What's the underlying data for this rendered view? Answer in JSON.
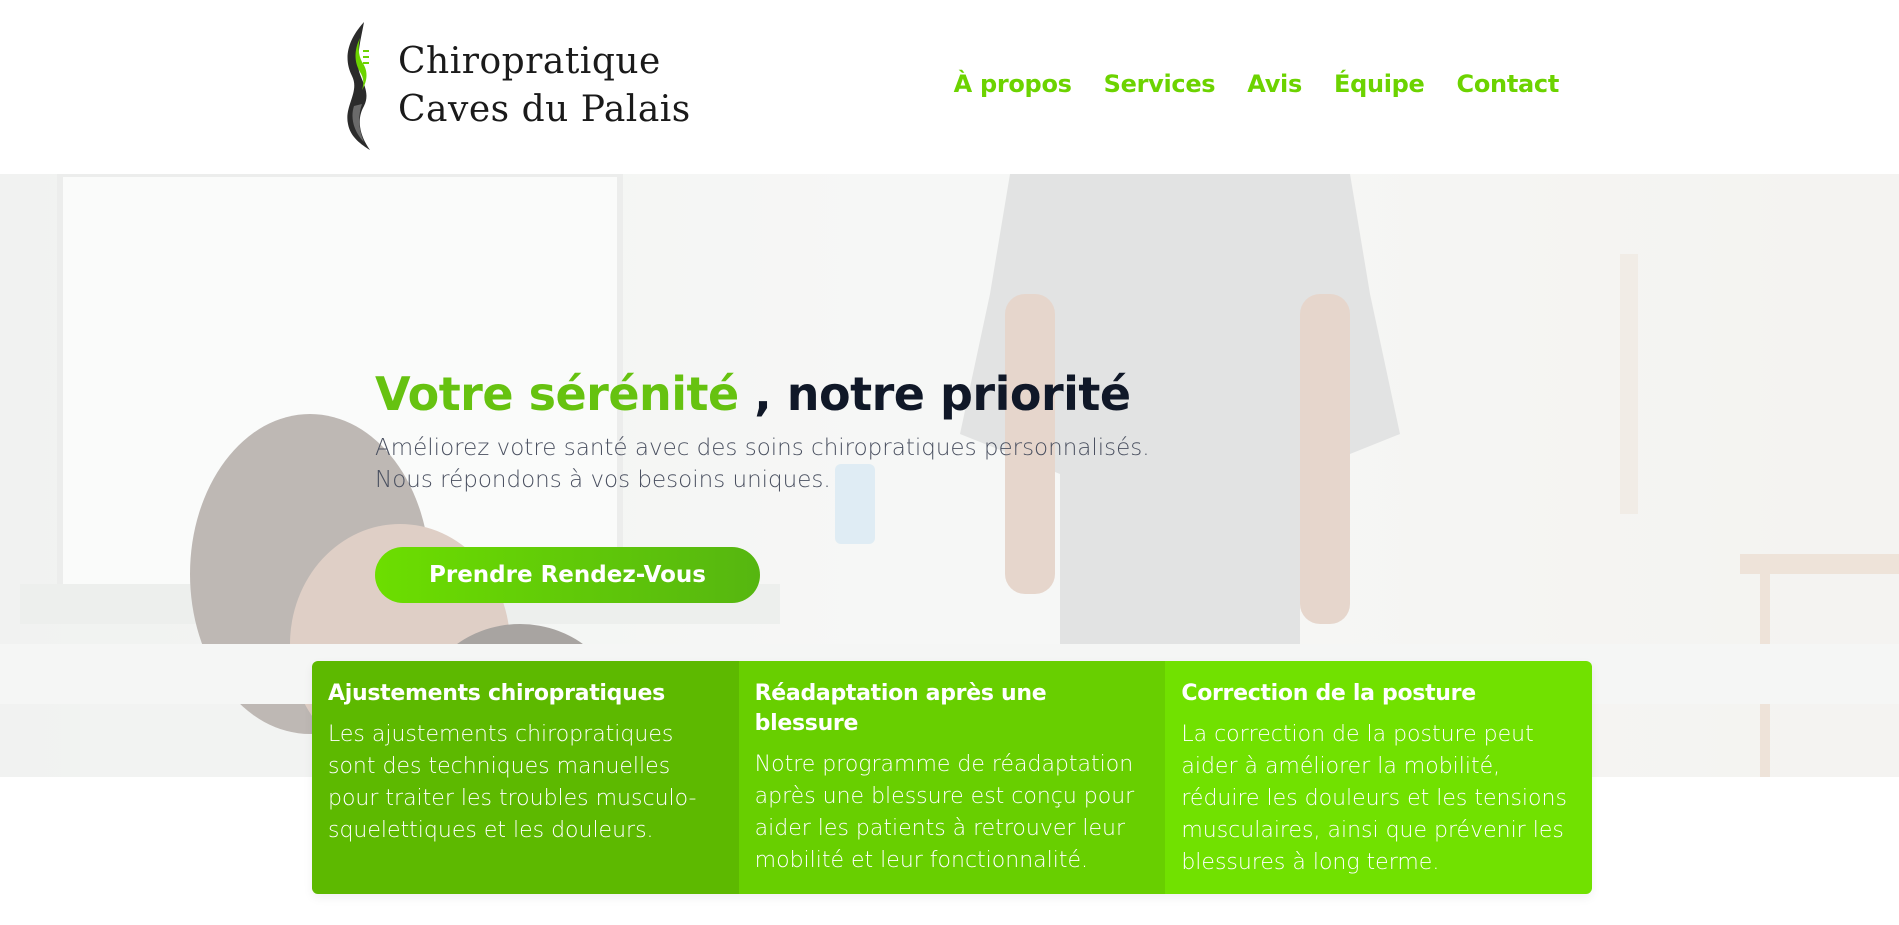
{
  "header": {
    "logo_lines": [
      "Chiropratique",
      "Caves du Palais"
    ],
    "nav": [
      {
        "label": "À propos"
      },
      {
        "label": "Services"
      },
      {
        "label": "Avis"
      },
      {
        "label": "Équipe"
      },
      {
        "label": "Contact"
      }
    ]
  },
  "hero": {
    "title_accent": "Votre sérénité",
    "title_rest": " , notre priorité",
    "subtitle_line1": "Améliorez votre santé avec des soins chiropratiques personnalisés.",
    "subtitle_line2": "Nous répondons à vos besoins uniques.",
    "cta_label": "Prendre Rendez-Vous"
  },
  "cards": [
    {
      "title": "Ajustements chiropratiques",
      "text": "Les ajustements chiropratiques sont des techniques manuelles pour traiter les troubles musculo-squelettiques et les douleurs."
    },
    {
      "title": "Réadaptation après une blessure",
      "text": "Notre programme de réadaptation après une blessure est conçu pour aider les patients à retrouver leur mobilité et leur fonctionnalité."
    },
    {
      "title": "Correction de la posture",
      "text": "La correction de la posture peut aider à améliorer la mobilité, réduire les douleurs et les tensions musculaires, ainsi que prévenir les blessures à long terme."
    }
  ],
  "colors": {
    "accent": "#6cd300",
    "dark_text": "#101828",
    "card_1": "#5db900",
    "card_2": "#68cf00",
    "card_3": "#71e100"
  },
  "icons": {
    "logo": "spine-logo-icon"
  }
}
